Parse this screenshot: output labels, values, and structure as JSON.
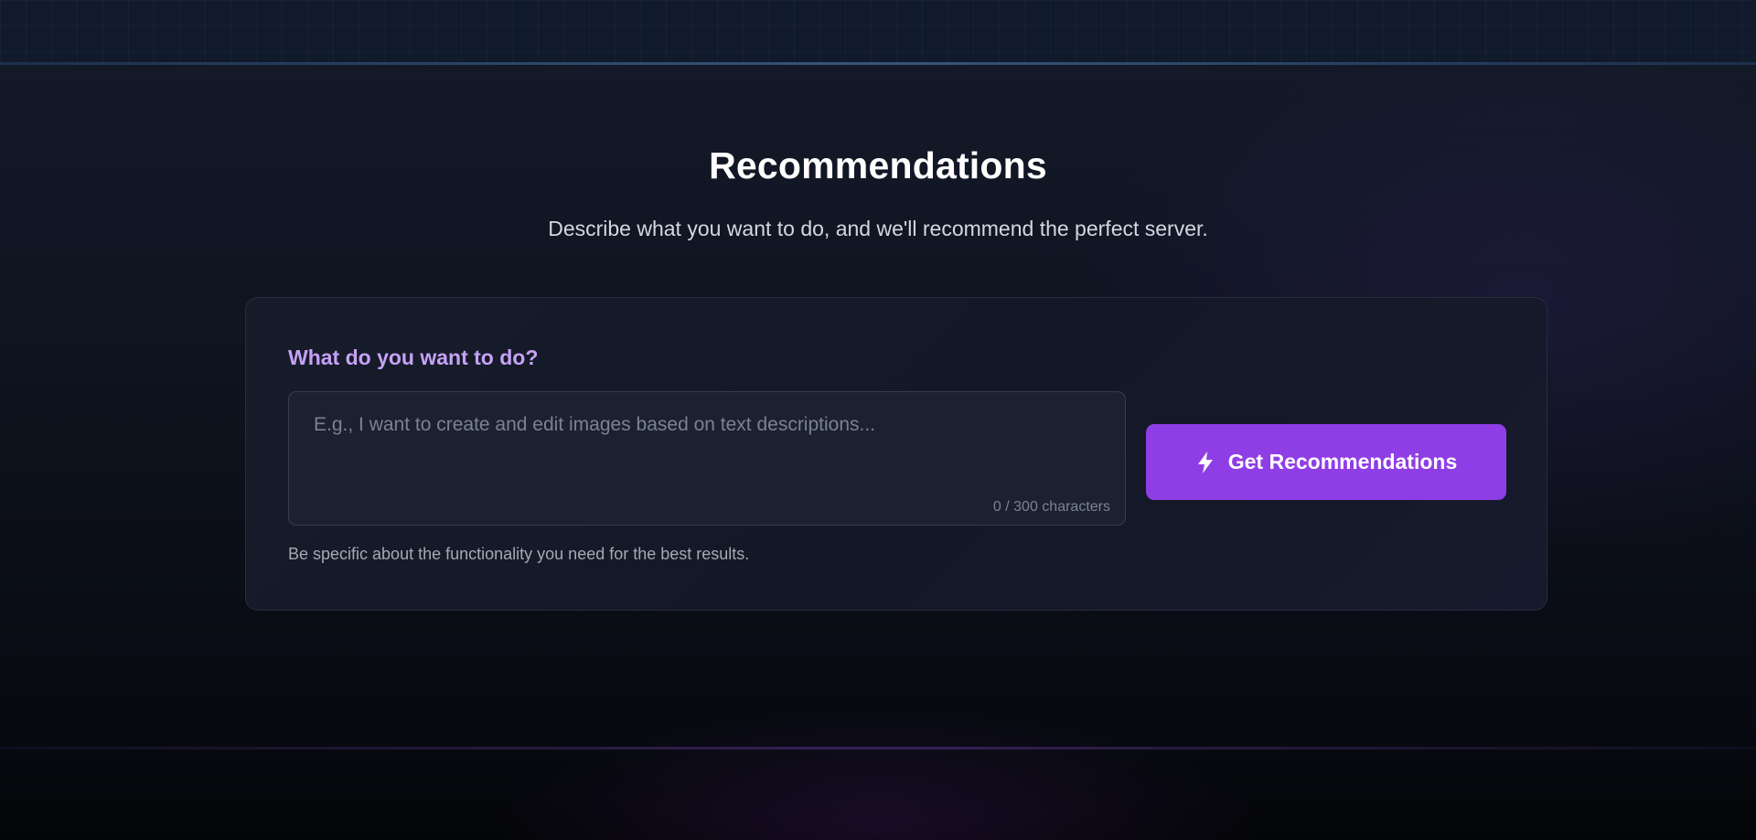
{
  "hero": {
    "title": "Recommendations",
    "subtitle": "Describe what you want to do, and we'll recommend the perfect server."
  },
  "form": {
    "label": "What do you want to do?",
    "input_value": "",
    "placeholder": "E.g., I want to create and edit images based on text descriptions...",
    "char_count": "0 / 300 characters",
    "hint": "Be specific about the functionality you need for the best results.",
    "submit_label": "Get Recommendations",
    "submit_icon": "lightning-bolt-icon"
  },
  "colors": {
    "accent": "#8f3ee6",
    "label": "#c6a2f7",
    "background": "#0b0f18"
  }
}
